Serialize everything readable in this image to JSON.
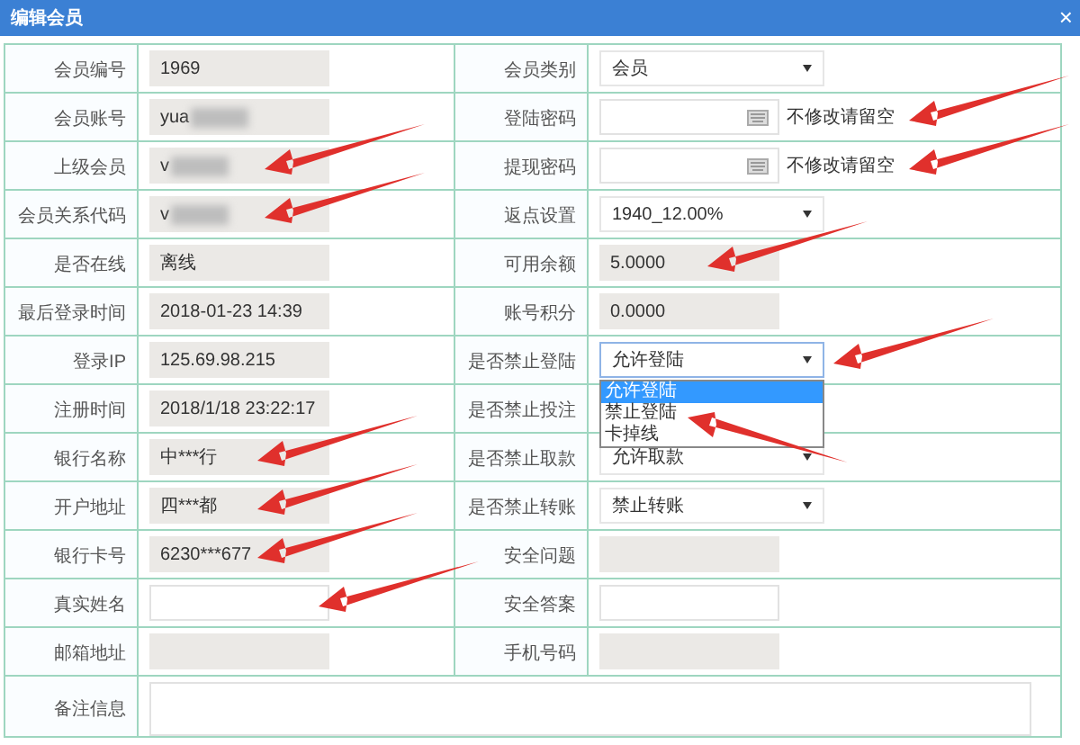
{
  "dialog": {
    "title": "编辑会员",
    "close": "×"
  },
  "rows": [
    {
      "cells": [
        {
          "label": "会员编号",
          "field": {
            "kind": "text",
            "value": "1969",
            "readonly": true
          }
        },
        {
          "label": "会员类别",
          "field": {
            "kind": "select",
            "value": "会员",
            "open": false
          }
        }
      ]
    },
    {
      "cells": [
        {
          "label": "会员账号",
          "field": {
            "kind": "text",
            "value": "yua",
            "readonly": true,
            "redacted": true
          }
        },
        {
          "label": "登陆密码",
          "field": {
            "kind": "password",
            "note": "不修改请留空",
            "arrow": true
          }
        }
      ]
    },
    {
      "cells": [
        {
          "label": "上级会员",
          "field": {
            "kind": "text",
            "value": "v",
            "readonly": true,
            "redacted": true,
            "arrow": true
          }
        },
        {
          "label": "提现密码",
          "field": {
            "kind": "password",
            "note": "不修改请留空",
            "arrow": true
          }
        }
      ]
    },
    {
      "cells": [
        {
          "label": "会员关系代码",
          "field": {
            "kind": "text",
            "value": "v",
            "readonly": true,
            "redacted": true,
            "arrow": true
          }
        },
        {
          "label": "返点设置",
          "field": {
            "kind": "select",
            "value": "1940_12.00%",
            "open": false
          }
        }
      ]
    },
    {
      "cells": [
        {
          "label": "是否在线",
          "field": {
            "kind": "text",
            "value": "离线",
            "readonly": true
          }
        },
        {
          "label": "可用余额",
          "field": {
            "kind": "text",
            "value": "5.0000",
            "readonly": true,
            "arrow": true
          }
        }
      ]
    },
    {
      "cells": [
        {
          "label": "最后登录时间",
          "field": {
            "kind": "text",
            "value": "2018-01-23 14:39",
            "readonly": true
          }
        },
        {
          "label": "账号积分",
          "field": {
            "kind": "text",
            "value": "0.0000",
            "readonly": true
          }
        }
      ]
    },
    {
      "cells": [
        {
          "label": "登录IP",
          "field": {
            "kind": "text",
            "value": "125.69.98.215",
            "readonly": true
          }
        },
        {
          "label": "是否禁止登陆",
          "field": {
            "kind": "select",
            "value": "允许登陆",
            "open": true,
            "arrow": true,
            "options": [
              {
                "label": "允许登陆",
                "selected": true
              },
              {
                "label": "禁止登陆",
                "selected": false,
                "arrow": true
              },
              {
                "label": "卡掉线",
                "selected": false
              }
            ]
          }
        }
      ]
    },
    {
      "cells": [
        {
          "label": "注册时间",
          "field": {
            "kind": "text",
            "value": "2018/1/18 23:22:17",
            "readonly": true
          }
        },
        {
          "label": "是否禁止投注"
        }
      ]
    },
    {
      "cells": [
        {
          "label": "银行名称",
          "field": {
            "kind": "text",
            "value": "中***行",
            "readonly": true,
            "arrow": true
          }
        },
        {
          "label": "是否禁止取款",
          "field": {
            "kind": "select",
            "value": "允许取款",
            "open": false
          }
        }
      ]
    },
    {
      "cells": [
        {
          "label": "开户地址",
          "field": {
            "kind": "text",
            "value": "四***都",
            "readonly": true,
            "arrow": true
          }
        },
        {
          "label": "是否禁止转账",
          "field": {
            "kind": "select",
            "value": "禁止转账",
            "open": false
          }
        }
      ]
    },
    {
      "cells": [
        {
          "label": "银行卡号",
          "field": {
            "kind": "text",
            "value": "6230***677",
            "readonly": true,
            "arrow": true
          }
        },
        {
          "label": "安全问题",
          "field": {
            "kind": "text",
            "readonly": true
          }
        }
      ]
    },
    {
      "cells": [
        {
          "label": "真实姓名",
          "field": {
            "kind": "text",
            "readonly": false,
            "arrow": true
          }
        },
        {
          "label": "安全答案",
          "field": {
            "kind": "text",
            "readonly": false
          }
        }
      ]
    },
    {
      "cells": [
        {
          "label": "邮箱地址",
          "field": {
            "kind": "text",
            "readonly": true
          }
        },
        {
          "label": "手机号码",
          "field": {
            "kind": "text",
            "readonly": true
          }
        }
      ]
    }
  ],
  "remarks": {
    "label": "备注信息"
  }
}
